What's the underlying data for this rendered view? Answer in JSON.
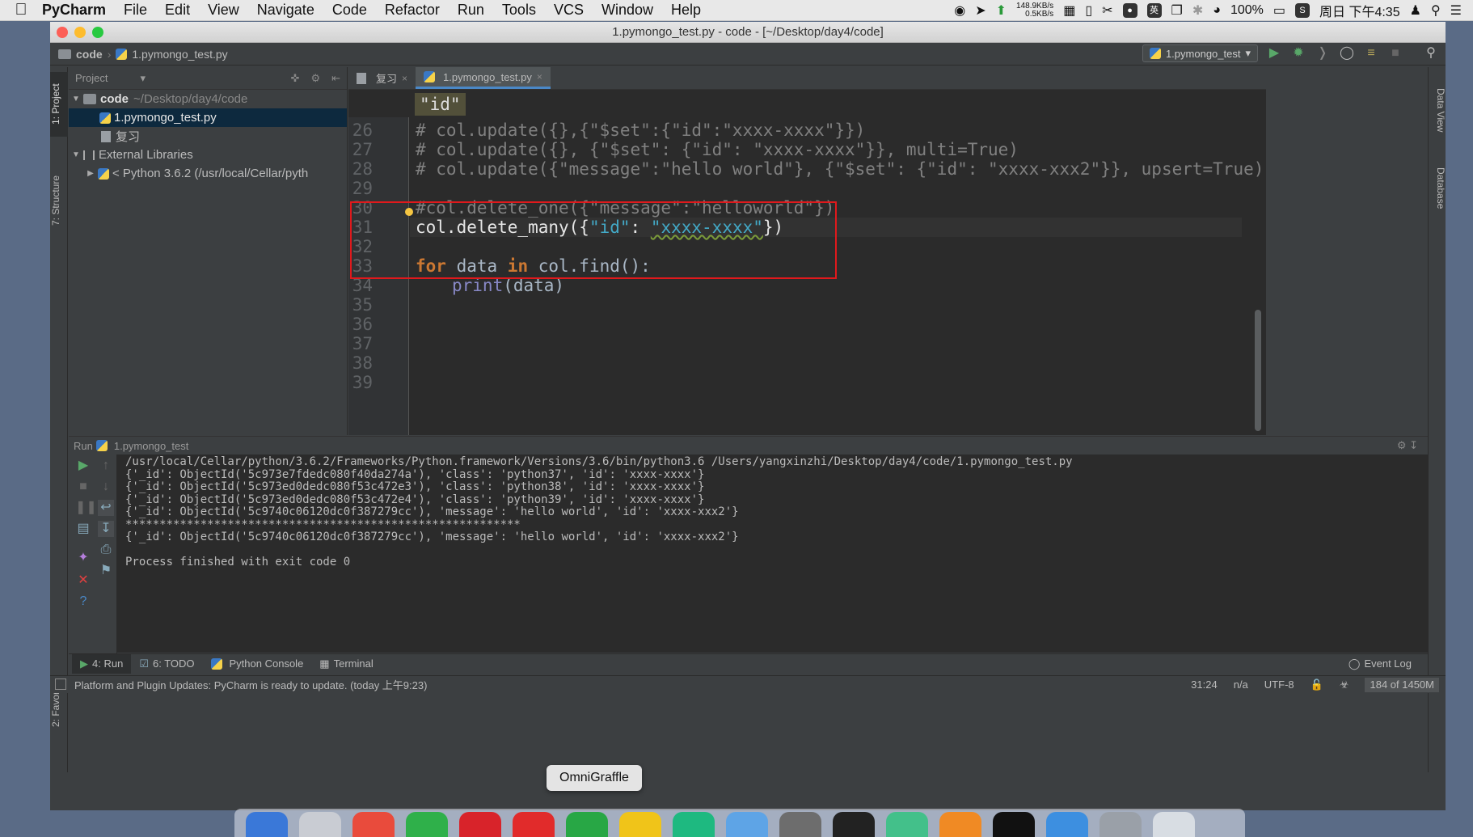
{
  "menubar": {
    "app": "PyCharm",
    "items": [
      "File",
      "Edit",
      "View",
      "Navigate",
      "Code",
      "Refactor",
      "Run",
      "Tools",
      "VCS",
      "Window",
      "Help"
    ],
    "net_up": "148.9KB/s",
    "net_down": "0.5KB/s",
    "battery": "100%",
    "clock": "周日 下午4:35",
    "ime": "英"
  },
  "window": {
    "title": "1.pymongo_test.py - code - [~/Desktop/day4/code]"
  },
  "navbar": {
    "crumb_root": "code",
    "crumb_file": "1.pymongo_test.py",
    "run_config": "1.pymongo_test"
  },
  "stripes": {
    "project": "1: Project",
    "structure": "7: Structure",
    "favorites": "2: Favorites",
    "data_view": "Data View",
    "database": "Database"
  },
  "project_panel": {
    "header": "Project",
    "root_name": "code",
    "root_path": "~/Desktop/day4/code",
    "file_selected": "1.pymongo_test.py",
    "file_other": "复习",
    "external": "External Libraries",
    "python": "< Python 3.6.2 (/usr/local/Cellar/pyth"
  },
  "editor": {
    "tabs": [
      {
        "label": "复习"
      },
      {
        "label": "1.pymongo_test.py"
      }
    ],
    "crumb_popup": "\"id\"",
    "line_numbers": [
      "26",
      "27",
      "28",
      "29",
      "30",
      "31",
      "32",
      "33",
      "34",
      "35",
      "36",
      "37",
      "38",
      "39"
    ],
    "code": {
      "l26": "# col.update({},{\"$set\":{\"id\":\"xxxx-xxxx\"}})",
      "l27": "# col.update({}, {\"$set\": {\"id\": \"xxxx-xxxx\"}}, multi=True)",
      "l28": "# col.update({\"message\":\"hello world\"}, {\"$set\": {\"id\": \"xxxx-xxx2\"}}, upsert=True)",
      "l30": "#col.delete_one({\"message\":\"helloworld\"})",
      "l31_a": "col.delete_many({",
      "l31_key": "\"id\"",
      "l31_colon": ": ",
      "l31_val": "\"xxxx-xxxx\"",
      "l31_end": "})",
      "l33_kw1": "for",
      "l33_mid": " data ",
      "l33_kw2": "in",
      "l33_end": " col.find():",
      "l34_fn": "print",
      "l34_end": "(data)"
    }
  },
  "run_panel": {
    "header_label": "Run",
    "header_config": "1.pymongo_test",
    "output": [
      "/usr/local/Cellar/python/3.6.2/Frameworks/Python.framework/Versions/3.6/bin/python3.6 /Users/yangxinzhi/Desktop/day4/code/1.pymongo_test.py",
      "{'_id': ObjectId('5c973e7fdedc080f40da274a'), 'class': 'python37', 'id': 'xxxx-xxxx'}",
      "{'_id': ObjectId('5c973ed0dedc080f53c472e3'), 'class': 'python38', 'id': 'xxxx-xxxx'}",
      "{'_id': ObjectId('5c973ed0dedc080f53c472e4'), 'class': 'python39', 'id': 'xxxx-xxxx'}",
      "{'_id': ObjectId('5c9740c06120dc0f387279cc'), 'message': 'hello world', 'id': 'xxxx-xxx2'}",
      "**********************************************************",
      "{'_id': ObjectId('5c9740c06120dc0f387279cc'), 'message': 'hello world', 'id': 'xxxx-xxx2'}",
      "",
      "Process finished with exit code 0"
    ]
  },
  "bottom_tabs": {
    "run": "4: Run",
    "todo": "6: TODO",
    "console": "Python Console",
    "terminal": "Terminal",
    "event_log": "Event Log"
  },
  "statusbar": {
    "message": "Platform and Plugin Updates: PyCharm is ready to update. (today 上午9:23)",
    "position": "31:24",
    "separator": "n/a",
    "encoding": "UTF-8",
    "memory": "184 of 1450M"
  },
  "tooltip": "OmniGraffle",
  "colors": {
    "accent": "#4a88c7",
    "highlight_box": "#e0191c",
    "editor_bg": "#2b2b2b",
    "panel_bg": "#3c3f41"
  }
}
